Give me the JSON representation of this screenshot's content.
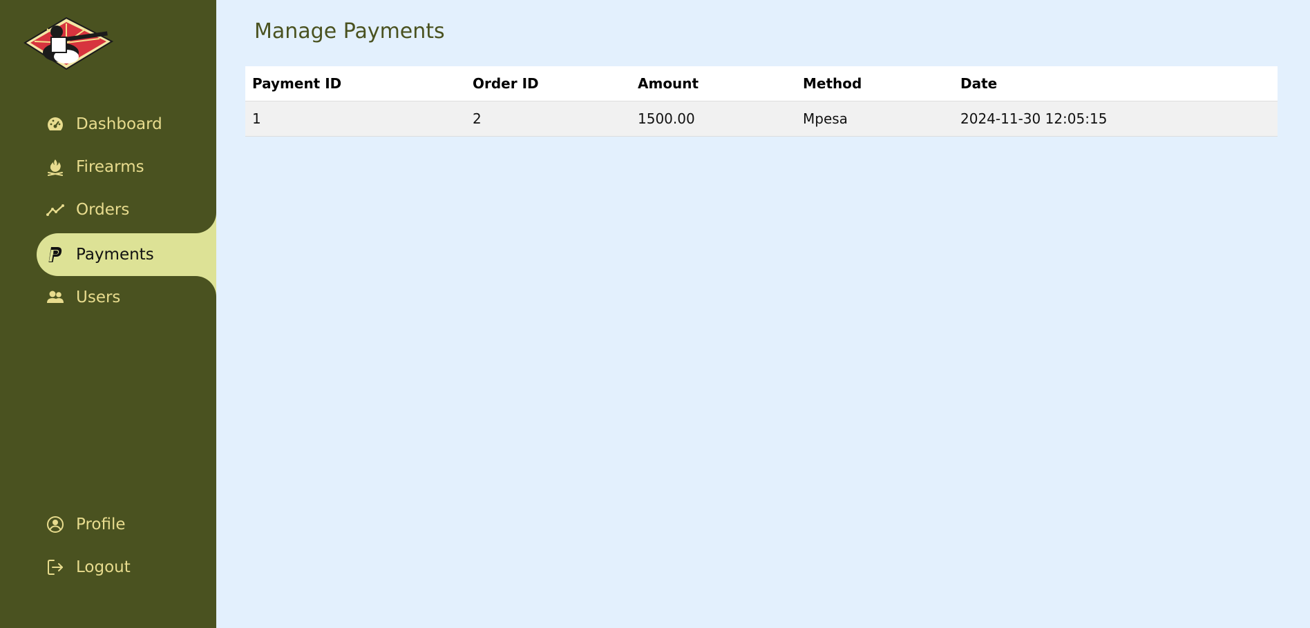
{
  "sidebar": {
    "nav": [
      {
        "label": "Dashboard",
        "icon": "dashboard-gauge-icon"
      },
      {
        "label": "Firearms",
        "icon": "firearms-icon"
      },
      {
        "label": "Orders",
        "icon": "chart-line-icon"
      },
      {
        "label": "Payments",
        "icon": "paypal-icon",
        "active": true
      },
      {
        "label": "Users",
        "icon": "users-icon"
      }
    ],
    "bottom": [
      {
        "label": "Profile",
        "icon": "user-circle-icon"
      },
      {
        "label": "Logout",
        "icon": "logout-icon"
      }
    ]
  },
  "main": {
    "title": "Manage Payments",
    "table": {
      "headers": [
        "Payment ID",
        "Order ID",
        "Amount",
        "Method",
        "Date"
      ],
      "rows": [
        [
          "1",
          "2",
          "1500.00",
          "Mpesa",
          "2024-11-30 12:05:15"
        ]
      ]
    }
  },
  "colors": {
    "sidebar_bg": "#4a5220",
    "nav_text": "#e8dc8e",
    "active_bg": "#dde296",
    "main_bg": "#e3f0fd",
    "title": "#4a5220"
  }
}
